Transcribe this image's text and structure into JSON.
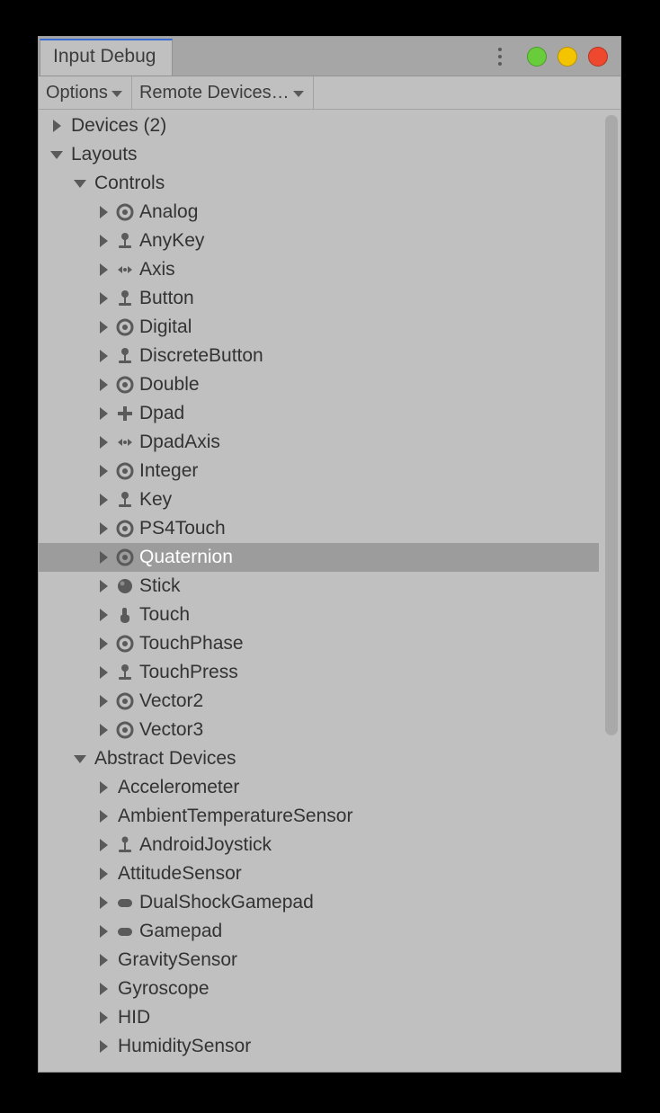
{
  "tab_title": "Input Debug",
  "toolbar": {
    "options": "Options",
    "remote": "Remote Devices…"
  },
  "tree": [
    {
      "depth": 0,
      "expanded": false,
      "icon": null,
      "label": "Devices (2)",
      "selected": false
    },
    {
      "depth": 0,
      "expanded": true,
      "icon": null,
      "label": "Layouts",
      "selected": false
    },
    {
      "depth": 1,
      "expanded": true,
      "icon": null,
      "label": "Controls",
      "selected": false
    },
    {
      "depth": 2,
      "expanded": false,
      "icon": "ring",
      "label": "Analog",
      "selected": false
    },
    {
      "depth": 2,
      "expanded": false,
      "icon": "joy",
      "label": "AnyKey",
      "selected": false
    },
    {
      "depth": 2,
      "expanded": false,
      "icon": "arrows",
      "label": "Axis",
      "selected": false
    },
    {
      "depth": 2,
      "expanded": false,
      "icon": "joy",
      "label": "Button",
      "selected": false
    },
    {
      "depth": 2,
      "expanded": false,
      "icon": "ring",
      "label": "Digital",
      "selected": false
    },
    {
      "depth": 2,
      "expanded": false,
      "icon": "joy",
      "label": "DiscreteButton",
      "selected": false
    },
    {
      "depth": 2,
      "expanded": false,
      "icon": "ring",
      "label": "Double",
      "selected": false
    },
    {
      "depth": 2,
      "expanded": false,
      "icon": "dpad",
      "label": "Dpad",
      "selected": false
    },
    {
      "depth": 2,
      "expanded": false,
      "icon": "arrows",
      "label": "DpadAxis",
      "selected": false
    },
    {
      "depth": 2,
      "expanded": false,
      "icon": "ring",
      "label": "Integer",
      "selected": false
    },
    {
      "depth": 2,
      "expanded": false,
      "icon": "joy",
      "label": "Key",
      "selected": false
    },
    {
      "depth": 2,
      "expanded": false,
      "icon": "ring",
      "label": "PS4Touch",
      "selected": false
    },
    {
      "depth": 2,
      "expanded": false,
      "icon": "ring",
      "label": "Quaternion",
      "selected": true
    },
    {
      "depth": 2,
      "expanded": false,
      "icon": "ball",
      "label": "Stick",
      "selected": false
    },
    {
      "depth": 2,
      "expanded": false,
      "icon": "finger",
      "label": "Touch",
      "selected": false
    },
    {
      "depth": 2,
      "expanded": false,
      "icon": "ring",
      "label": "TouchPhase",
      "selected": false
    },
    {
      "depth": 2,
      "expanded": false,
      "icon": "joy",
      "label": "TouchPress",
      "selected": false
    },
    {
      "depth": 2,
      "expanded": false,
      "icon": "ring",
      "label": "Vector2",
      "selected": false
    },
    {
      "depth": 2,
      "expanded": false,
      "icon": "ring",
      "label": "Vector3",
      "selected": false
    },
    {
      "depth": 1,
      "expanded": true,
      "icon": null,
      "label": "Abstract Devices",
      "selected": false
    },
    {
      "depth": 2,
      "expanded": false,
      "icon": null,
      "label": "Accelerometer",
      "selected": false
    },
    {
      "depth": 2,
      "expanded": false,
      "icon": null,
      "label": "AmbientTemperatureSensor",
      "selected": false
    },
    {
      "depth": 2,
      "expanded": false,
      "icon": "joy2",
      "label": "AndroidJoystick",
      "selected": false
    },
    {
      "depth": 2,
      "expanded": false,
      "icon": null,
      "label": "AttitudeSensor",
      "selected": false
    },
    {
      "depth": 2,
      "expanded": false,
      "icon": "pad",
      "label": "DualShockGamepad",
      "selected": false
    },
    {
      "depth": 2,
      "expanded": false,
      "icon": "pad",
      "label": "Gamepad",
      "selected": false
    },
    {
      "depth": 2,
      "expanded": false,
      "icon": null,
      "label": "GravitySensor",
      "selected": false
    },
    {
      "depth": 2,
      "expanded": false,
      "icon": null,
      "label": "Gyroscope",
      "selected": false
    },
    {
      "depth": 2,
      "expanded": false,
      "icon": null,
      "label": "HID",
      "selected": false
    },
    {
      "depth": 2,
      "expanded": false,
      "icon": null,
      "label": "HumiditySensor",
      "selected": false
    }
  ]
}
